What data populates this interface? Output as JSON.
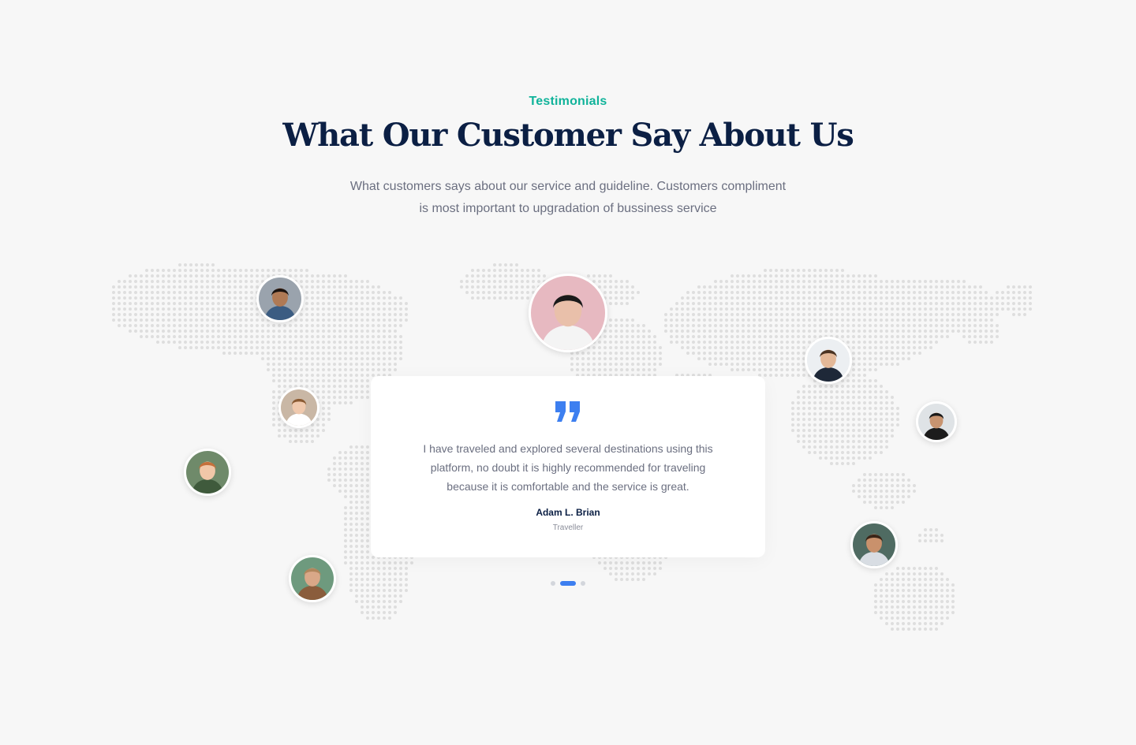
{
  "section": {
    "eyebrow": "Testimonials",
    "title": "What Our Customer Say About Us",
    "subtitle_line1": "What customers says about our service and guideline. Customers compliment",
    "subtitle_line2": "is most important to upgradation of bussiness service"
  },
  "testimonial": {
    "quote_icon": "quote-icon",
    "text_line1": "I have traveled and explored several destinations using this",
    "text_line2": "platform, no doubt it is highly recommended for traveling",
    "text_line3": "because it is comfortable and the service is great.",
    "author": "Adam L. Brian",
    "role": "Traveller"
  },
  "carousel": {
    "slide_count": 3,
    "active_index": 1
  },
  "colors": {
    "accent_teal": "#10b39a",
    "heading_navy": "#0b1f44",
    "body_gray": "#6b6f80",
    "primary_blue": "#3d7ff0",
    "map_dot": "#dedede"
  },
  "avatars": [
    {
      "name": "avatar-man-beard",
      "skin": "#b07a55",
      "hair": "#1d1410",
      "bg": "#9aa3ad",
      "shirt": "#3b5c82"
    },
    {
      "name": "avatar-woman-hijab-featured",
      "skin": "#e9c0aa",
      "hair": "#1a1a1a",
      "bg": "#e7b9c1",
      "shirt": "#f4f4f4"
    },
    {
      "name": "avatar-man-suit",
      "skin": "#e3b898",
      "hair": "#4a3322",
      "bg": "#eceff2",
      "shirt": "#1e2838"
    },
    {
      "name": "avatar-man-dark-shirt",
      "skin": "#c89470",
      "hair": "#1a1a1a",
      "bg": "#dfe3e6",
      "shirt": "#1c1c1c"
    },
    {
      "name": "avatar-woman-smiling",
      "skin": "#f0c9ad",
      "hair": "#8a5a32",
      "bg": "#c9b7a5",
      "shirt": "#ffffff"
    },
    {
      "name": "avatar-man-redhair",
      "skin": "#f1c7a8",
      "hair": "#c4703b",
      "bg": "#6f8a6a",
      "shirt": "#3f5a3c"
    },
    {
      "name": "avatar-woman-headscarf",
      "skin": "#d9a888",
      "hair": "#b0865c",
      "bg": "#6e9a7e",
      "shirt": "#8a5d3c"
    },
    {
      "name": "avatar-woman-curly",
      "skin": "#c9916c",
      "hair": "#3a2518",
      "bg": "#4f6b62",
      "shirt": "#d8dde3"
    }
  ]
}
